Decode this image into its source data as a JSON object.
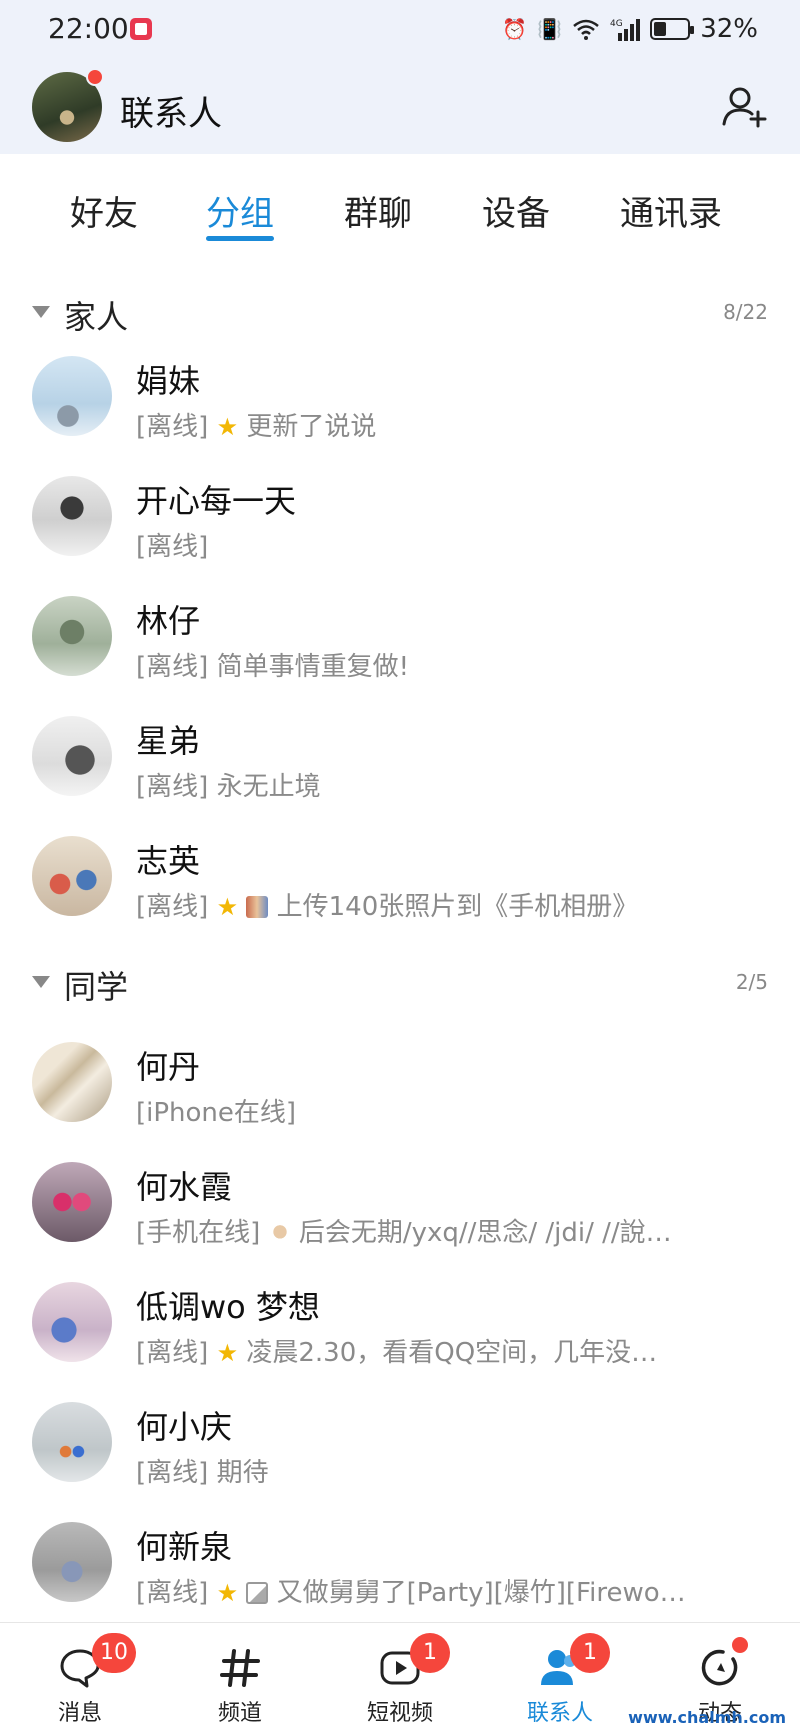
{
  "status_bar": {
    "time": "22:00",
    "battery_pct": "32%",
    "icons": [
      "alarm-icon",
      "vibrate-icon",
      "wifi-icon",
      "signal-4g-icon",
      "battery-icon"
    ]
  },
  "header": {
    "title": "联系人",
    "avatar_has_notification": true,
    "add_contact_icon": "add-person-icon"
  },
  "tabs": [
    {
      "label": "好友",
      "active": false
    },
    {
      "label": "分组",
      "active": true
    },
    {
      "label": "群聊",
      "active": false
    },
    {
      "label": "设备",
      "active": false
    },
    {
      "label": "通讯录",
      "active": false
    }
  ],
  "groups": [
    {
      "name": "家人",
      "count": "8/22",
      "contacts": [
        {
          "name": "娟妹",
          "prefix": "[离线]",
          "status": "更新了说说",
          "star": true,
          "pic": false
        },
        {
          "name": "开心每一天",
          "prefix": "[离线]",
          "status": "",
          "star": false,
          "pic": false
        },
        {
          "name": "林仔",
          "prefix": "[离线]",
          "status": "简单事情重复做!",
          "star": false,
          "pic": false
        },
        {
          "name": "星弟",
          "prefix": "[离线]",
          "status": "永无止境",
          "star": false,
          "pic": false
        },
        {
          "name": "志英",
          "prefix": "[离线]",
          "status": "上传140张照片到《手机相册》",
          "star": true,
          "pic": true
        }
      ]
    },
    {
      "name": "同学",
      "count": "2/5",
      "contacts": [
        {
          "name": "何丹",
          "prefix": "[iPhone在线]",
          "status": "",
          "star": false,
          "pic": false
        },
        {
          "name": "何水霞",
          "prefix": "[手机在线]",
          "status": "后会无期/yxq//思念/ /jdi/ //說…",
          "star": false,
          "pic": true
        },
        {
          "name": "低调wo 梦想",
          "prefix": "[离线]",
          "status": "凌晨2.30，看看QQ空间，几年没…",
          "star": true,
          "pic": false
        },
        {
          "name": "何小庆",
          "prefix": "[离线]",
          "status": "期待",
          "star": false,
          "pic": false
        },
        {
          "name": "何新泉",
          "prefix": "[离线]",
          "status": "又做舅舅了[Party][爆竹][Firewo…",
          "star": true,
          "pic": true
        }
      ]
    }
  ],
  "bottom_nav": [
    {
      "label": "消息",
      "icon": "message-icon",
      "badge": "10",
      "active": false
    },
    {
      "label": "频道",
      "icon": "channel-hash-icon",
      "badge": "",
      "active": false
    },
    {
      "label": "短视频",
      "icon": "short-video-icon",
      "badge": "1",
      "active": false
    },
    {
      "label": "联系人",
      "icon": "contacts-icon",
      "badge": "1",
      "active": true
    },
    {
      "label": "动态",
      "icon": "moments-icon",
      "badge": "dot",
      "active": false
    }
  ],
  "watermark": "www.chalmh.com",
  "colors": {
    "accent": "#1a8ad8",
    "badge": "#f5463c",
    "header_bg": "#eef2fa"
  }
}
